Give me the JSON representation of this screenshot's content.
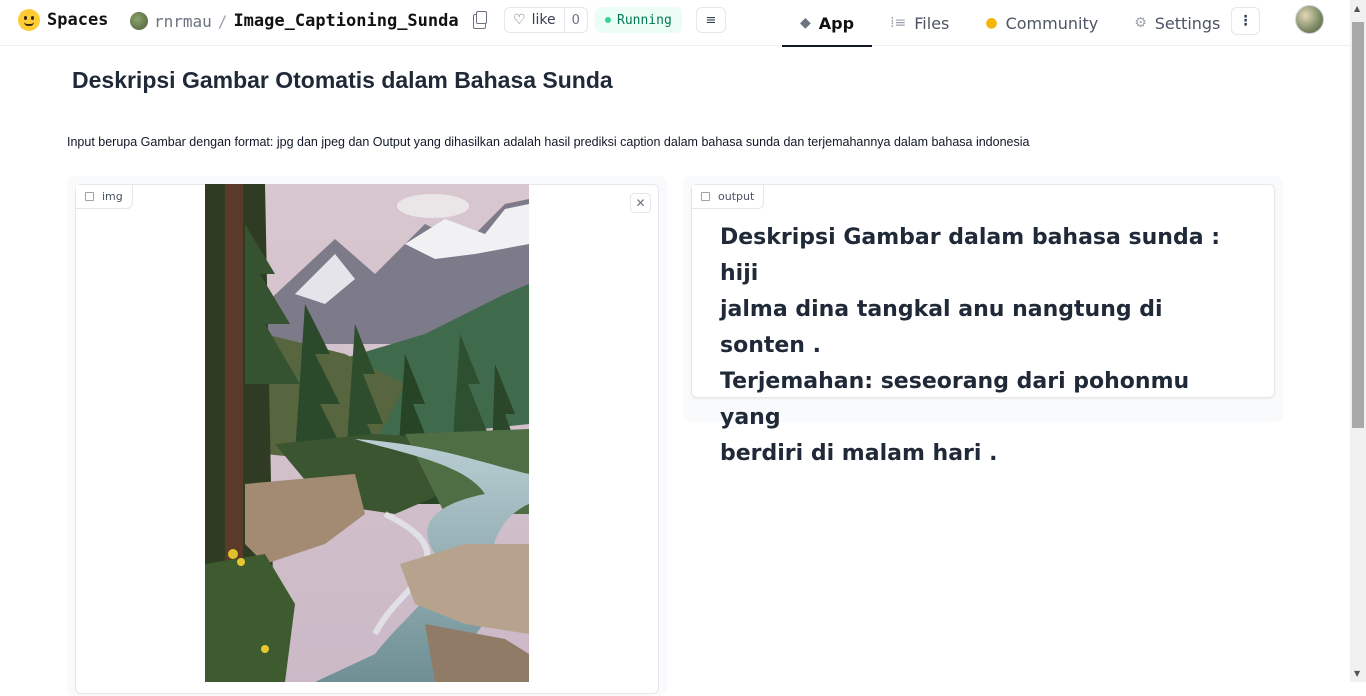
{
  "header": {
    "brand_label": "Spaces",
    "owner": "rnrmau",
    "separator": "/",
    "repo": "Image_Captioning_Sunda",
    "like_label": "like",
    "like_count": "0",
    "status": "Running",
    "nav": [
      {
        "label": "App",
        "icon": "cube-icon",
        "active": true
      },
      {
        "label": "Files",
        "icon": "files-icon",
        "active": false
      },
      {
        "label": "Community",
        "icon": "community-icon",
        "active": false
      },
      {
        "label": "Settings",
        "icon": "gear-icon",
        "active": false
      }
    ]
  },
  "main": {
    "title": "Deskripsi Gambar Otomatis dalam Bahasa Sunda",
    "description": "Input berupa Gambar dengan format: jpg dan jpeg dan Output yang dihasilkan adalah hasil prediksi caption dalam bahasa sunda dan terjemahannya dalam bahasa indonesia",
    "image_input": {
      "label": "img"
    },
    "output": {
      "label": "output",
      "text": "Deskripsi Gambar dalam bahasa sunda : hiji\njalma dina tangkal anu nangtung di sonten .\nTerjemahan: seseorang dari pohonmu yang\nberdiri di malam hari ."
    }
  },
  "colors": {
    "status_green": "#047857",
    "accent_yellow": "#f5b50a"
  }
}
